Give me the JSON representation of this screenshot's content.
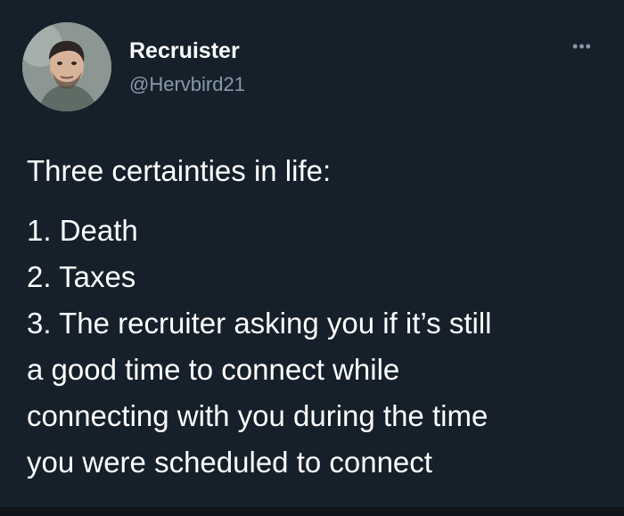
{
  "user": {
    "display_name": "Recruister",
    "handle": "@Hervbird21"
  },
  "menu": {
    "more_icon": "more-horizontal-icon",
    "more_glyph": "•••"
  },
  "tweet": {
    "intro": "Three certainties in life:",
    "items": [
      "1. Death",
      "2. Taxes",
      "3. The recruiter asking you if it’s still",
      "a good time to connect while",
      "connecting with you during the time",
      "you were scheduled to connect"
    ]
  },
  "colors": {
    "background": "#15202b",
    "text": "#ffffff",
    "secondary_text": "#8899a6"
  }
}
